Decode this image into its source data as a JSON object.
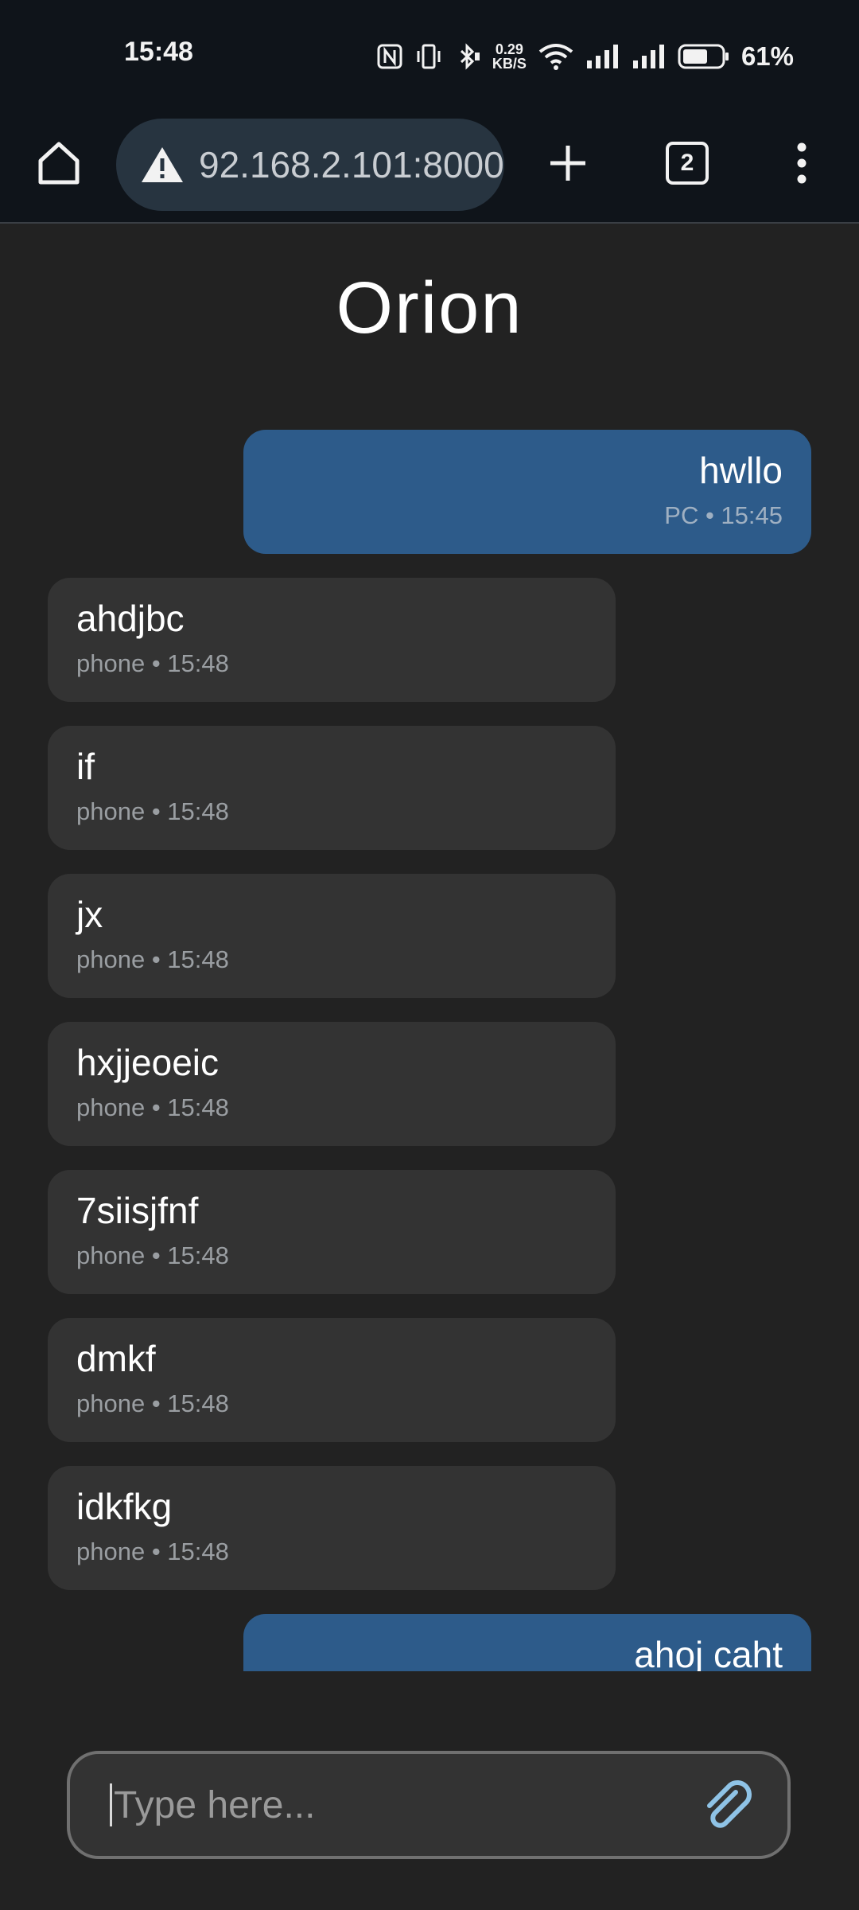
{
  "status_bar": {
    "time": "15:48",
    "net_speed_value": "0.29",
    "net_speed_unit": "KB/S",
    "battery_percent": "61%",
    "icons": [
      "nfc-icon",
      "vibrate-icon",
      "bluetooth-icon",
      "wifi-icon",
      "signal-icon",
      "signal-icon",
      "battery-icon"
    ]
  },
  "browser": {
    "url": "92.168.2.101:8000",
    "tab_count": "2",
    "icons": [
      "home-icon",
      "warning-icon",
      "plus-icon",
      "tabs-icon",
      "more-vert-icon"
    ]
  },
  "page": {
    "title": "Orion"
  },
  "messages": [
    {
      "direction": "outgoing",
      "text": "hwllo",
      "meta": "PC • 15:45"
    },
    {
      "direction": "incoming",
      "text": "ahdjbc",
      "meta": "phone • 15:48"
    },
    {
      "direction": "incoming",
      "text": "if",
      "meta": "phone • 15:48"
    },
    {
      "direction": "incoming",
      "text": "jx",
      "meta": "phone • 15:48"
    },
    {
      "direction": "incoming",
      "text": "hxjjeoeic",
      "meta": "phone • 15:48"
    },
    {
      "direction": "incoming",
      "text": "7siisjfnf",
      "meta": "phone • 15:48"
    },
    {
      "direction": "incoming",
      "text": "dmkf",
      "meta": "phone • 15:48"
    },
    {
      "direction": "incoming",
      "text": "idkfkg",
      "meta": "phone • 15:48"
    },
    {
      "direction": "outgoing",
      "text": "ahoj caht",
      "meta": ""
    }
  ],
  "composer": {
    "placeholder": "Type here...",
    "value": "",
    "attach_icon": "paperclip-icon"
  },
  "colors": {
    "background": "#222222",
    "incoming_bubble": "#333333",
    "outgoing_bubble": "#2d5b8a",
    "top_bar": "#0f141a",
    "url_pill": "#273440"
  }
}
